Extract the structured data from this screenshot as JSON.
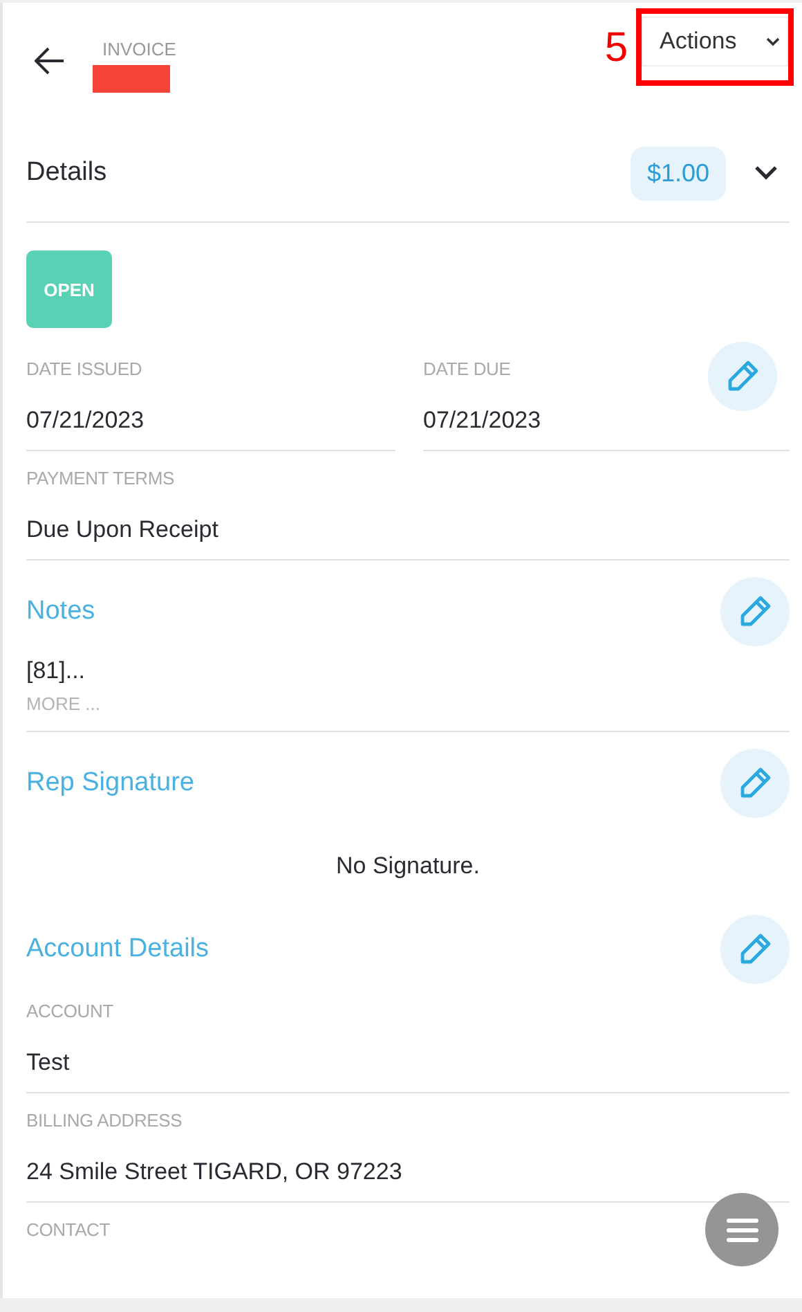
{
  "header": {
    "label": "INVOICE",
    "annotation": "5",
    "actions": "Actions"
  },
  "details": {
    "title": "Details",
    "amount": "$1.00",
    "status": "OPEN"
  },
  "dates": [
    {
      "label": "DATE ISSUED",
      "value": "07/21/2023"
    },
    {
      "label": "DATE DUE",
      "value": "07/21/2023"
    }
  ],
  "payment_terms": {
    "label": "PAYMENT TERMS",
    "value": "Due Upon Receipt"
  },
  "notes": {
    "title": "Notes",
    "text": "[81]...",
    "more": "MORE ..."
  },
  "rep_signature": {
    "title": "Rep Signature",
    "text": "No Signature."
  },
  "account_details": {
    "title": "Account Details",
    "fields": [
      {
        "label": "ACCOUNT",
        "value": "Test"
      },
      {
        "label": "BILLING ADDRESS",
        "value": "24 Smile Street TIGARD, OR 97223"
      },
      {
        "label": "CONTACT"
      }
    ]
  }
}
